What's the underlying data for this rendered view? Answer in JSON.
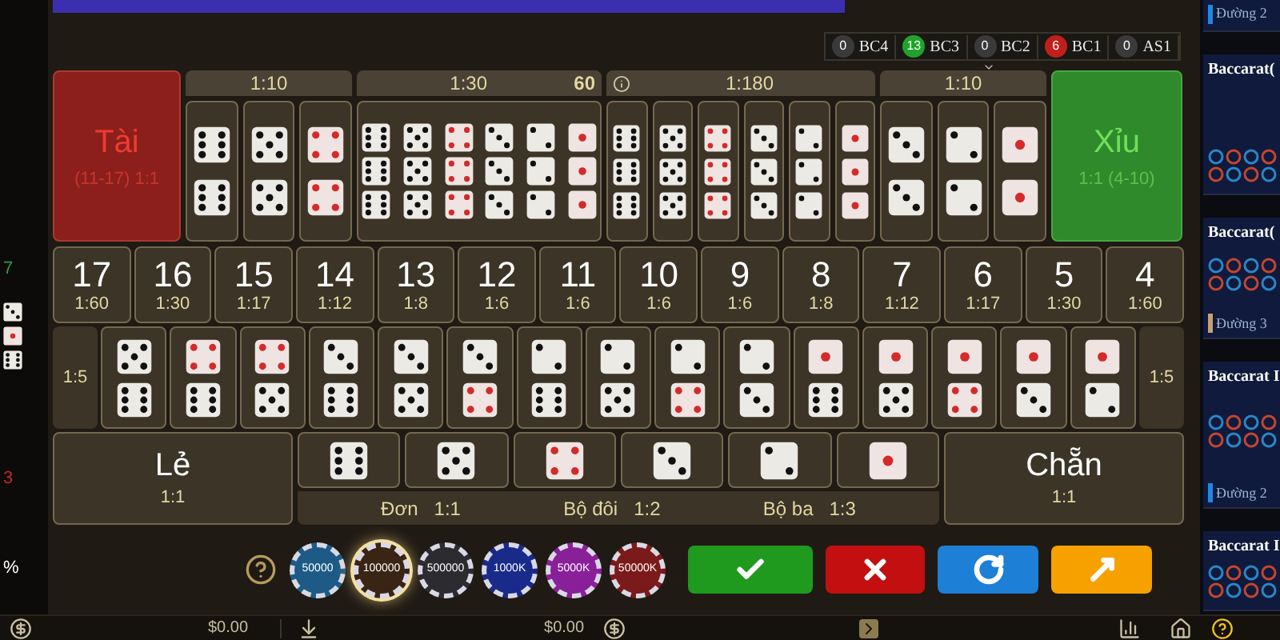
{
  "left_panel": {
    "values": [
      {
        "text": "7",
        "color": "#2e9e3e"
      },
      {
        "text": "3",
        "color": "#c62828"
      },
      {
        "text": "%",
        "color": "#ffffff"
      }
    ]
  },
  "top_bar": {
    "counters": [
      {
        "count": "0",
        "label": "BC4",
        "color": "#3a3a3a"
      },
      {
        "count": "13",
        "label": "BC3",
        "color": "#1fa32a"
      },
      {
        "count": "0",
        "label": "BC2",
        "color": "#3a3a3a"
      },
      {
        "count": "6",
        "label": "BC1",
        "color": "#c0201c"
      },
      {
        "count": "0",
        "label": "AS1",
        "color": "#3a3a3a"
      }
    ]
  },
  "board": {
    "big": {
      "label": "Tài",
      "odds": "(11-17) 1:1"
    },
    "small": {
      "label": "Xỉu",
      "odds": "1:1 (4-10)"
    },
    "sections": [
      {
        "kind": "double",
        "header": "1:10",
        "cells": [
          [
            {
              "kind": "six"
            },
            {
              "kind": "six"
            }
          ],
          [
            {
              "kind": "five"
            },
            {
              "kind": "five"
            }
          ],
          [
            {
              "kind": "four"
            },
            {
              "kind": "four"
            }
          ]
        ]
      },
      {
        "kind": "any_triple",
        "header": "1:30",
        "countdown": "60",
        "cells": [
          [
            {
              "kind": "six"
            },
            {
              "kind": "five"
            },
            {
              "kind": "four"
            },
            {
              "kind": "three"
            },
            {
              "kind": "two"
            },
            {
              "kind": "one"
            }
          ]
        ]
      },
      {
        "kind": "triple",
        "header": "1:180",
        "cells": [
          [
            {
              "kind": "six"
            },
            {
              "kind": "six"
            },
            {
              "kind": "six"
            }
          ],
          [
            {
              "kind": "five"
            },
            {
              "kind": "five"
            },
            {
              "kind": "five"
            }
          ],
          [
            {
              "kind": "four"
            },
            {
              "kind": "four"
            },
            {
              "kind": "four"
            }
          ],
          [
            {
              "kind": "three"
            },
            {
              "kind": "three"
            },
            {
              "kind": "three"
            }
          ],
          [
            {
              "kind": "two"
            },
            {
              "kind": "two"
            },
            {
              "kind": "two"
            }
          ],
          [
            {
              "kind": "one"
            },
            {
              "kind": "one"
            },
            {
              "kind": "one"
            }
          ]
        ]
      },
      {
        "kind": "double",
        "header": "1:10",
        "cells": [
          [
            {
              "kind": "three"
            },
            {
              "kind": "three"
            }
          ],
          [
            {
              "kind": "two"
            },
            {
              "kind": "two"
            }
          ],
          [
            {
              "kind": "one"
            },
            {
              "kind": "one"
            }
          ]
        ]
      }
    ],
    "sums": [
      {
        "total": "17",
        "odds": "1:60"
      },
      {
        "total": "16",
        "odds": "1:30"
      },
      {
        "total": "15",
        "odds": "1:17"
      },
      {
        "total": "14",
        "odds": "1:12"
      },
      {
        "total": "13",
        "odds": "1:8"
      },
      {
        "total": "12",
        "odds": "1:6"
      },
      {
        "total": "11",
        "odds": "1:6"
      },
      {
        "total": "10",
        "odds": "1:6"
      },
      {
        "total": "9",
        "odds": "1:6"
      },
      {
        "total": "8",
        "odds": "1:8"
      },
      {
        "total": "7",
        "odds": "1:12"
      },
      {
        "total": "6",
        "odds": "1:17"
      },
      {
        "total": "5",
        "odds": "1:30"
      },
      {
        "total": "4",
        "odds": "1:60"
      }
    ],
    "combo_odds_left": "1:5",
    "combo_odds_right": "1:5",
    "combos": [
      [
        {
          "kind": "five"
        },
        {
          "kind": "six"
        }
      ],
      [
        {
          "kind": "four"
        },
        {
          "kind": "six"
        }
      ],
      [
        {
          "kind": "four"
        },
        {
          "kind": "five"
        }
      ],
      [
        {
          "kind": "three"
        },
        {
          "kind": "six"
        }
      ],
      [
        {
          "kind": "three"
        },
        {
          "kind": "five"
        }
      ],
      [
        {
          "kind": "three"
        },
        {
          "kind": "four"
        }
      ],
      [
        {
          "kind": "two"
        },
        {
          "kind": "six"
        }
      ],
      [
        {
          "kind": "two"
        },
        {
          "kind": "five"
        }
      ],
      [
        {
          "kind": "two"
        },
        {
          "kind": "four"
        }
      ],
      [
        {
          "kind": "two"
        },
        {
          "kind": "three"
        }
      ],
      [
        {
          "kind": "one"
        },
        {
          "kind": "six"
        }
      ],
      [
        {
          "kind": "one"
        },
        {
          "kind": "five"
        }
      ],
      [
        {
          "kind": "one"
        },
        {
          "kind": "four"
        }
      ],
      [
        {
          "kind": "one"
        },
        {
          "kind": "three"
        }
      ],
      [
        {
          "kind": "one"
        },
        {
          "kind": "two"
        }
      ]
    ],
    "odd": {
      "label": "Lẻ",
      "odds": "1:1"
    },
    "even": {
      "label": "Chẵn",
      "odds": "1:1"
    },
    "singles": [
      {
        "kind": "six"
      },
      {
        "kind": "five"
      },
      {
        "kind": "four"
      },
      {
        "kind": "three"
      },
      {
        "kind": "two"
      },
      {
        "kind": "one"
      }
    ],
    "single_labels": [
      {
        "name": "Đơn",
        "odds": "1:1"
      },
      {
        "name": "Bộ đôi",
        "odds": "1:2"
      },
      {
        "name": "Bộ ba",
        "odds": "1:3"
      }
    ]
  },
  "chips": [
    {
      "label": "50000",
      "color": "#1d5b86",
      "selected": false
    },
    {
      "label": "100000",
      "color": "#3a2414",
      "selected": true
    },
    {
      "label": "500000",
      "color": "#2c2c30",
      "selected": false
    },
    {
      "label": "1000K",
      "color": "#1a2a8a",
      "selected": false
    },
    {
      "label": "5000K",
      "color": "#8a1f9a",
      "selected": false
    },
    {
      "label": "50000K",
      "color": "#7a1a1a",
      "selected": false
    }
  ],
  "actions": [
    {
      "kind": "confirm"
    },
    {
      "kind": "cancel"
    },
    {
      "kind": "repeat"
    },
    {
      "kind": "double"
    }
  ],
  "balances": [
    "$0.00",
    "$0.00"
  ],
  "tables": [
    {
      "road": "Đường 2",
      "color": "#1e88e5"
    },
    {
      "title": "Baccarat("
    },
    {
      "title": "Baccarat(",
      "road": "Đường 3",
      "color": "#c8a070"
    },
    {
      "title": "Baccarat I",
      "road": "Đường 2",
      "color": "#1e88e5"
    },
    {
      "title": "Baccarat I"
    }
  ]
}
